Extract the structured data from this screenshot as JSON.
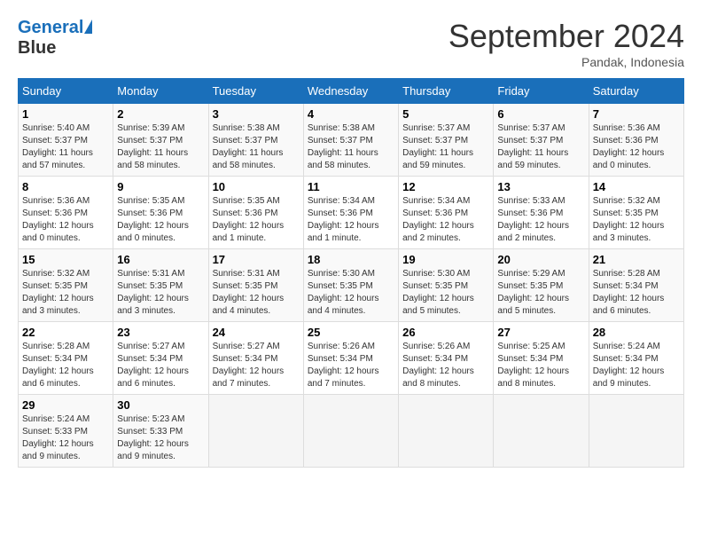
{
  "header": {
    "logo_line1": "General",
    "logo_line2": "Blue",
    "month_title": "September 2024",
    "subtitle": "Pandak, Indonesia"
  },
  "days_of_week": [
    "Sunday",
    "Monday",
    "Tuesday",
    "Wednesday",
    "Thursday",
    "Friday",
    "Saturday"
  ],
  "weeks": [
    [
      {
        "day": "1",
        "sunrise": "5:40 AM",
        "sunset": "5:37 PM",
        "daylight": "11 hours and 57 minutes."
      },
      {
        "day": "2",
        "sunrise": "5:39 AM",
        "sunset": "5:37 PM",
        "daylight": "11 hours and 58 minutes."
      },
      {
        "day": "3",
        "sunrise": "5:38 AM",
        "sunset": "5:37 PM",
        "daylight": "11 hours and 58 minutes."
      },
      {
        "day": "4",
        "sunrise": "5:38 AM",
        "sunset": "5:37 PM",
        "daylight": "11 hours and 58 minutes."
      },
      {
        "day": "5",
        "sunrise": "5:37 AM",
        "sunset": "5:37 PM",
        "daylight": "11 hours and 59 minutes."
      },
      {
        "day": "6",
        "sunrise": "5:37 AM",
        "sunset": "5:37 PM",
        "daylight": "11 hours and 59 minutes."
      },
      {
        "day": "7",
        "sunrise": "5:36 AM",
        "sunset": "5:36 PM",
        "daylight": "12 hours and 0 minutes."
      }
    ],
    [
      {
        "day": "8",
        "sunrise": "5:36 AM",
        "sunset": "5:36 PM",
        "daylight": "12 hours and 0 minutes."
      },
      {
        "day": "9",
        "sunrise": "5:35 AM",
        "sunset": "5:36 PM",
        "daylight": "12 hours and 0 minutes."
      },
      {
        "day": "10",
        "sunrise": "5:35 AM",
        "sunset": "5:36 PM",
        "daylight": "12 hours and 1 minute."
      },
      {
        "day": "11",
        "sunrise": "5:34 AM",
        "sunset": "5:36 PM",
        "daylight": "12 hours and 1 minute."
      },
      {
        "day": "12",
        "sunrise": "5:34 AM",
        "sunset": "5:36 PM",
        "daylight": "12 hours and 2 minutes."
      },
      {
        "day": "13",
        "sunrise": "5:33 AM",
        "sunset": "5:36 PM",
        "daylight": "12 hours and 2 minutes."
      },
      {
        "day": "14",
        "sunrise": "5:32 AM",
        "sunset": "5:35 PM",
        "daylight": "12 hours and 3 minutes."
      }
    ],
    [
      {
        "day": "15",
        "sunrise": "5:32 AM",
        "sunset": "5:35 PM",
        "daylight": "12 hours and 3 minutes."
      },
      {
        "day": "16",
        "sunrise": "5:31 AM",
        "sunset": "5:35 PM",
        "daylight": "12 hours and 3 minutes."
      },
      {
        "day": "17",
        "sunrise": "5:31 AM",
        "sunset": "5:35 PM",
        "daylight": "12 hours and 4 minutes."
      },
      {
        "day": "18",
        "sunrise": "5:30 AM",
        "sunset": "5:35 PM",
        "daylight": "12 hours and 4 minutes."
      },
      {
        "day": "19",
        "sunrise": "5:30 AM",
        "sunset": "5:35 PM",
        "daylight": "12 hours and 5 minutes."
      },
      {
        "day": "20",
        "sunrise": "5:29 AM",
        "sunset": "5:35 PM",
        "daylight": "12 hours and 5 minutes."
      },
      {
        "day": "21",
        "sunrise": "5:28 AM",
        "sunset": "5:34 PM",
        "daylight": "12 hours and 6 minutes."
      }
    ],
    [
      {
        "day": "22",
        "sunrise": "5:28 AM",
        "sunset": "5:34 PM",
        "daylight": "12 hours and 6 minutes."
      },
      {
        "day": "23",
        "sunrise": "5:27 AM",
        "sunset": "5:34 PM",
        "daylight": "12 hours and 6 minutes."
      },
      {
        "day": "24",
        "sunrise": "5:27 AM",
        "sunset": "5:34 PM",
        "daylight": "12 hours and 7 minutes."
      },
      {
        "day": "25",
        "sunrise": "5:26 AM",
        "sunset": "5:34 PM",
        "daylight": "12 hours and 7 minutes."
      },
      {
        "day": "26",
        "sunrise": "5:26 AM",
        "sunset": "5:34 PM",
        "daylight": "12 hours and 8 minutes."
      },
      {
        "day": "27",
        "sunrise": "5:25 AM",
        "sunset": "5:34 PM",
        "daylight": "12 hours and 8 minutes."
      },
      {
        "day": "28",
        "sunrise": "5:24 AM",
        "sunset": "5:34 PM",
        "daylight": "12 hours and 9 minutes."
      }
    ],
    [
      {
        "day": "29",
        "sunrise": "5:24 AM",
        "sunset": "5:33 PM",
        "daylight": "12 hours and 9 minutes."
      },
      {
        "day": "30",
        "sunrise": "5:23 AM",
        "sunset": "5:33 PM",
        "daylight": "12 hours and 9 minutes."
      },
      null,
      null,
      null,
      null,
      null
    ]
  ],
  "labels": {
    "sunrise": "Sunrise:",
    "sunset": "Sunset:",
    "daylight": "Daylight:"
  }
}
